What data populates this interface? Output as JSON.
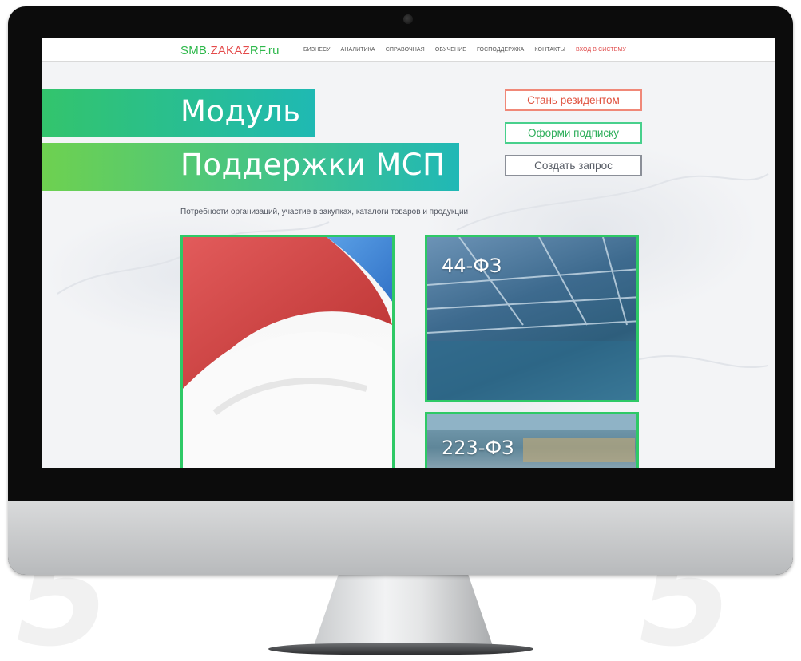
{
  "site": {
    "logo": {
      "part1": "SMB.",
      "part2": "ZAKAZ",
      "part3": "RF",
      "part4": ".ru"
    },
    "nav": [
      "БИЗНЕСУ",
      "АНАЛИТИКА",
      "СПРАВОЧНАЯ",
      "ОБУЧЕНИЕ",
      "ГОСПОДДЕРЖКА",
      "КОНТАКТЫ"
    ],
    "login_label": "ВХОД В СИСТЕМУ"
  },
  "hero": {
    "line1": "Модуль",
    "line2": "Поддержки МСП",
    "subtitle": "Потребности организаций, участие в закупках, каталоги товаров и продукции"
  },
  "actions": {
    "resident": "Стань резидентом",
    "subscribe": "Оформи подписку",
    "request": "Создать запрос"
  },
  "cards": {
    "fz44": "44-ФЗ",
    "fz223": "223-ФЗ"
  },
  "colors": {
    "brand_green": "#2eb84b",
    "brand_red": "#e44a4a",
    "card_border": "#2ec966"
  }
}
